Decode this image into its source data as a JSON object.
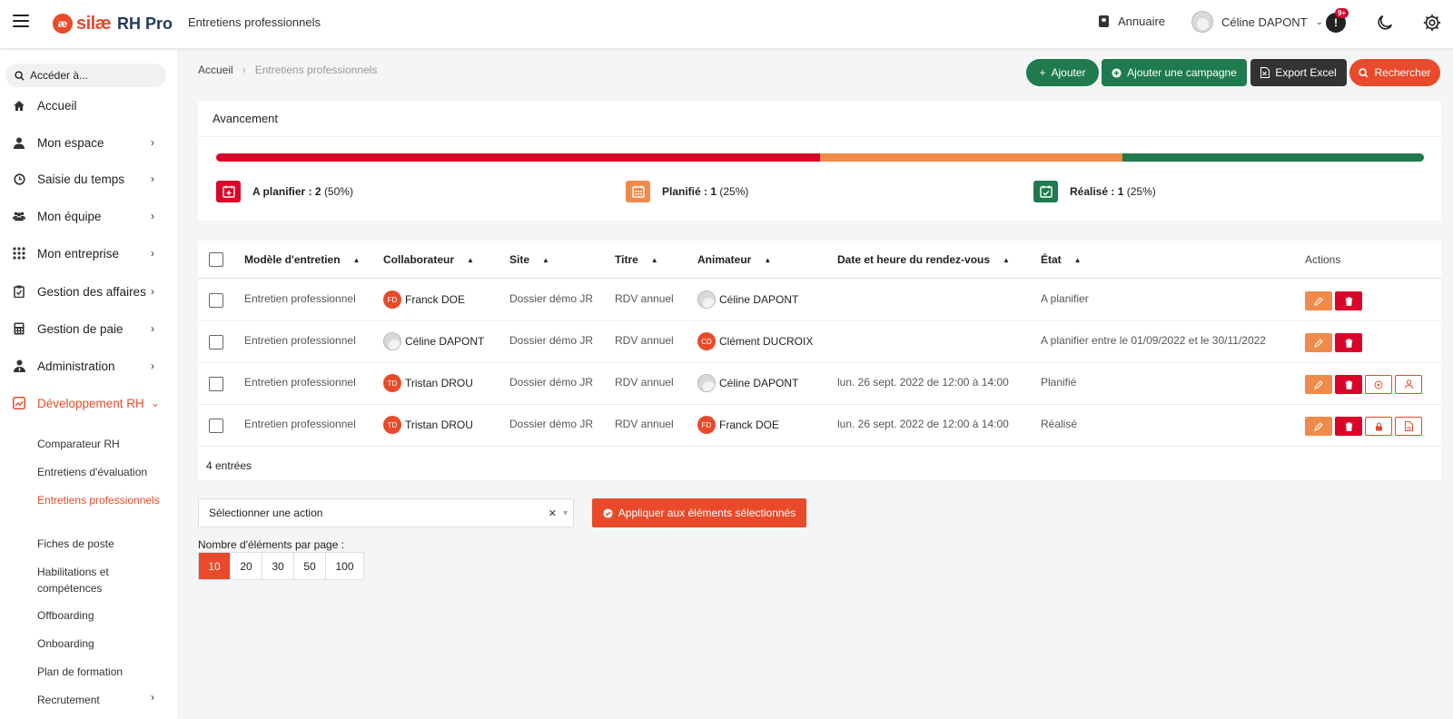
{
  "header": {
    "logo_text": "silæ",
    "logo_suffix": "RH Pro",
    "app_title": "Entretiens professionnels",
    "directory_label": "Annuaire",
    "user_name": "Céline DAPONT",
    "notif_badge": "9+"
  },
  "sidebar": {
    "search_placeholder": "Accéder à...",
    "items": [
      {
        "label": "Accueil",
        "icon": "home-icon"
      },
      {
        "label": "Mon espace",
        "icon": "user-icon"
      },
      {
        "label": "Saisie du temps",
        "icon": "clock-icon"
      },
      {
        "label": "Mon équipe",
        "icon": "team-icon"
      },
      {
        "label": "Mon entreprise",
        "icon": "grid-icon"
      },
      {
        "label": "Gestion des affaires",
        "icon": "clipboard-icon"
      },
      {
        "label": "Gestion de paie",
        "icon": "calculator-icon"
      },
      {
        "label": "Administration",
        "icon": "admin-icon"
      },
      {
        "label": "Développement RH",
        "icon": "chart-icon"
      }
    ],
    "subitems": [
      "Comparateur RH",
      "Entretiens d'évaluation",
      "Entretiens professionnels",
      "Fiches de poste",
      "Habilitations et compétences",
      "Offboarding",
      "Onboarding",
      "Plan de formation",
      "Recrutement"
    ]
  },
  "breadcrumb": {
    "home": "Accueil",
    "current": "Entretiens professionnels"
  },
  "toolbar": {
    "add": "Ajouter",
    "add_campaign": "Ajouter une campagne",
    "export": "Export Excel",
    "search": "Rechercher"
  },
  "progress": {
    "title": "Avancement",
    "colors": {
      "to_plan": "#d90429",
      "planned": "#f08a4b",
      "done": "#1f7a4d"
    },
    "shares": {
      "to_plan": 0.5,
      "planned": 0.25,
      "done": 0.25
    },
    "to_plan_label": "A planifier : ",
    "to_plan_count": "2",
    "to_plan_pct": "(50%)",
    "planned_label": "Planifié : ",
    "planned_count": "1",
    "planned_pct": "(25%)",
    "done_label": "Réalisé : ",
    "done_count": "1",
    "done_pct": "(25%)"
  },
  "table": {
    "headers": [
      "Modèle d'entretien",
      "Collaborateur",
      "Site",
      "Titre",
      "Animateur",
      "Date et heure du rendez-vous",
      "État",
      "Actions"
    ],
    "rows": [
      {
        "model": "Entretien professionnel",
        "collab": "Franck DOE",
        "collab_ini": "FD",
        "site": "Dossier démo JR",
        "title": "RDV annuel",
        "anim": "Céline DAPONT",
        "anim_ini": "",
        "date": "",
        "state": "A planifier"
      },
      {
        "model": "Entretien professionnel",
        "collab": "Céline DAPONT",
        "collab_ini": "",
        "site": "Dossier démo JR",
        "title": "RDV annuel",
        "anim": "Clément DUCROIX",
        "anim_ini": "CD",
        "date": "",
        "state": "A planifier entre le 01/09/2022 et le 30/11/2022"
      },
      {
        "model": "Entretien professionnel",
        "collab": "Tristan DROU",
        "collab_ini": "TD",
        "site": "Dossier démo JR",
        "title": "RDV annuel",
        "anim": "Céline DAPONT",
        "anim_ini": "",
        "date": "lun. 26 sept. 2022 de 12:00 à 14:00",
        "state": "Planifié"
      },
      {
        "model": "Entretien professionnel",
        "collab": "Tristan DROU",
        "collab_ini": "TD",
        "site": "Dossier démo JR",
        "title": "RDV annuel",
        "anim": "Franck DOE",
        "anim_ini": "FD",
        "date": "lun. 26 sept. 2022 de 12:00 à 14:00",
        "state": "Réalisé"
      }
    ],
    "entries": "4 entrées"
  },
  "bulk": {
    "select_placeholder": "Sélectionner une action",
    "apply_label": "Appliquer aux éléments sélectionnés"
  },
  "pagination": {
    "label": "Nombre d'éléments par page :",
    "options": [
      "10",
      "20",
      "30",
      "50",
      "100"
    ],
    "selected": "10"
  }
}
